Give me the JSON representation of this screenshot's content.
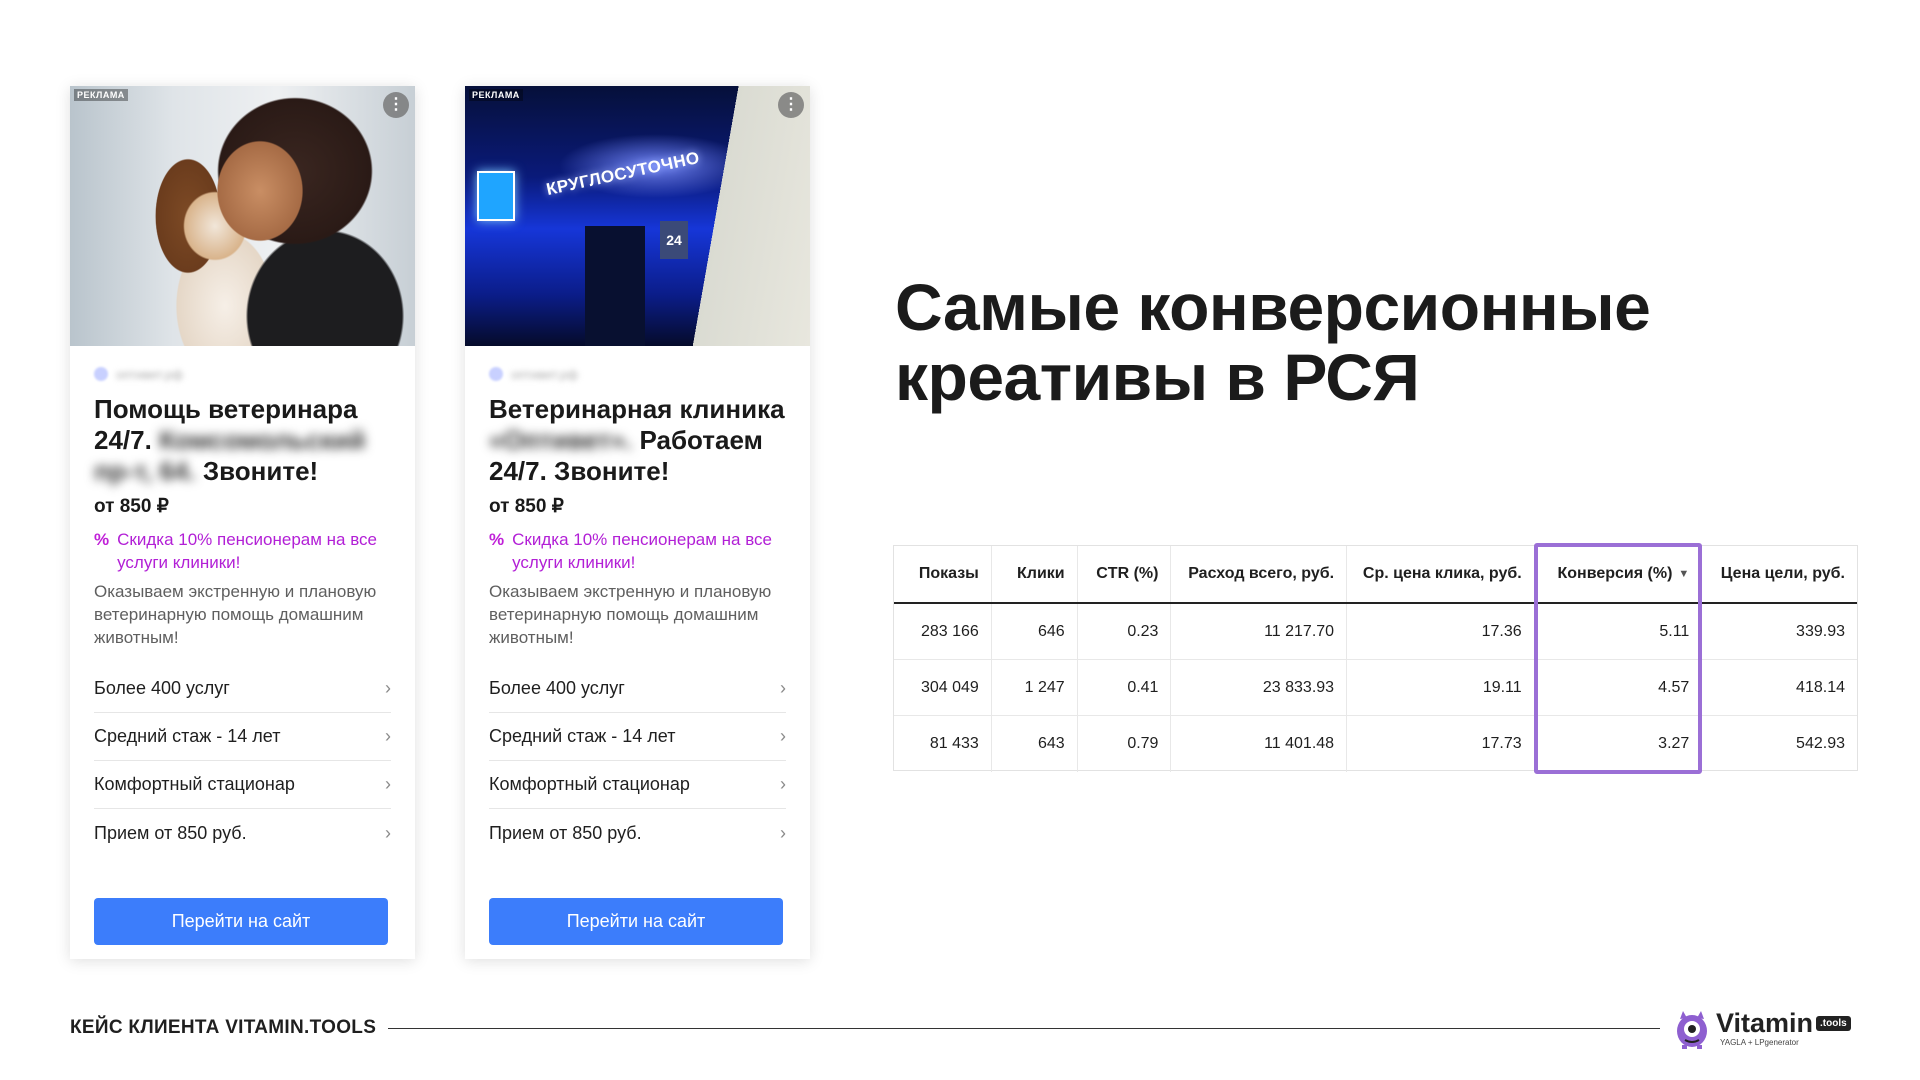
{
  "card1": {
    "ad_label": "РЕКЛАМА",
    "source": "oптивет.рф",
    "headline_a": "Помощь ветеринара 24/7.",
    "headline_blur": "Комсомольский пр-т, 64.",
    "headline_b": "Звоните!",
    "price": "от 850 ₽",
    "promo": "Скидка 10% пенсионерам на все услуги клиники!",
    "desc": "Оказываем экстренную и плановую ветеринарную помощь домашним животным!",
    "links": [
      "Более 400 услуг",
      "Средний стаж - 14 лет",
      "Комфортный стационар",
      "Прием от 850 руб."
    ],
    "cta": "Перейти на сайт"
  },
  "card2": {
    "ad_label": "РЕКЛАМА",
    "source": "oптивет.рф",
    "sign_text": "КРУГЛОСУТОЧНО",
    "house_number": "24",
    "headline_a": "Ветеринарная клиника",
    "headline_blur": "«Оптивет».",
    "headline_b": "Работаем 24/7. Звоните!",
    "price": "от 850 ₽",
    "promo": "Скидка 10% пенсионерам на все услуги клиники!",
    "desc": "Оказываем экстренную и плановую ветеринарную помощь домашним животным!",
    "links": [
      "Более 400 услуг",
      "Средний стаж - 14 лет",
      "Комфортный стационар",
      "Прием от 850 руб."
    ],
    "cta": "Перейти на сайт"
  },
  "title_line1": "Самые конверсионные",
  "title_line2": "креативы в РСЯ",
  "table": {
    "headers": [
      "Показы",
      "Клики",
      "CTR (%)",
      "Расход всего, руб.",
      "Ср. цена клика, руб.",
      "Конверсия (%)",
      "Цена цели, руб."
    ],
    "sort_indicator": "▼",
    "rows": [
      [
        "283 166",
        "646",
        "0.23",
        "11 217.70",
        "17.36",
        "5.11",
        "339.93"
      ],
      [
        "304 049",
        "1 247",
        "0.41",
        "23 833.93",
        "19.11",
        "4.57",
        "418.14"
      ],
      [
        "81 433",
        "643",
        "0.79",
        "11 401.48",
        "17.73",
        "3.27",
        "542.93"
      ]
    ],
    "highlight_color": "#9b6fd6"
  },
  "footer": {
    "case_label": "КЕЙС КЛИЕНТА VITAMIN.TOOLS",
    "logo_name": "Vitamin",
    "logo_badge": ".tools",
    "logo_sub": "YAGLA + LPgenerator"
  },
  "icons": {
    "more": "more-vertical-icon",
    "chevron": "chevron-right-icon",
    "percent": "percent-icon"
  },
  "colors": {
    "cta": "#3c7dfb",
    "promo": "#b21fd6",
    "highlight": "#9b6fd6"
  }
}
